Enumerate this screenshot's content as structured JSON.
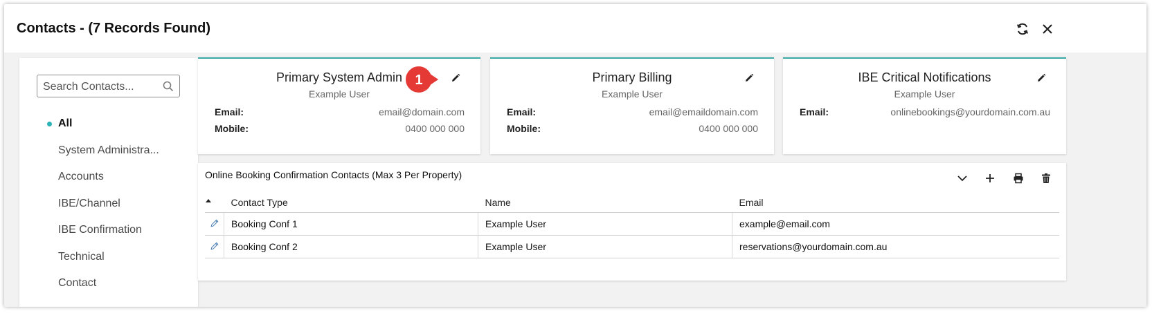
{
  "window": {
    "title": "Contacts - (7 Records Found)"
  },
  "sidebar": {
    "search_placeholder": "Search Contacts...",
    "items": [
      {
        "label": "All",
        "active": true
      },
      {
        "label": "System Administra..."
      },
      {
        "label": "Accounts"
      },
      {
        "label": "IBE/Channel"
      },
      {
        "label": "IBE Confirmation"
      },
      {
        "label": "Technical"
      },
      {
        "label": "Contact"
      }
    ]
  },
  "cards": [
    {
      "title": "Primary System Admin",
      "subtitle": "Example User",
      "email_label": "Email:",
      "email": "email@domain.com",
      "mobile_label": "Mobile:",
      "mobile": "0400 000 000"
    },
    {
      "title": "Primary Billing",
      "subtitle": "Example User",
      "email_label": "Email:",
      "email": "email@emaildomain.com",
      "mobile_label": "Mobile:",
      "mobile": "0400 000 000"
    },
    {
      "title": "IBE Critical Notifications",
      "subtitle": "Example User",
      "email_label": "Email:",
      "email": "onlinebookings@yourdomain.com.au"
    }
  ],
  "callout": {
    "number": "1",
    "color": "#e53935"
  },
  "booking_panel": {
    "title": "Online Booking Confirmation Contacts (Max 3 Per Property)",
    "columns": [
      "Contact Type",
      "Name",
      "Email"
    ],
    "rows": [
      {
        "contact_type": "Booking Conf 1",
        "name": "Example User",
        "email": "example@email.com"
      },
      {
        "contact_type": "Booking Conf 2",
        "name": "Example User",
        "email": "reservations@yourdomain.com.au"
      }
    ],
    "actions": [
      "chevron-down-icon",
      "plus-icon",
      "print-icon",
      "trash-icon"
    ]
  },
  "colors": {
    "accent": "#3aa9a6",
    "active_dot": "#2bb3b8"
  }
}
